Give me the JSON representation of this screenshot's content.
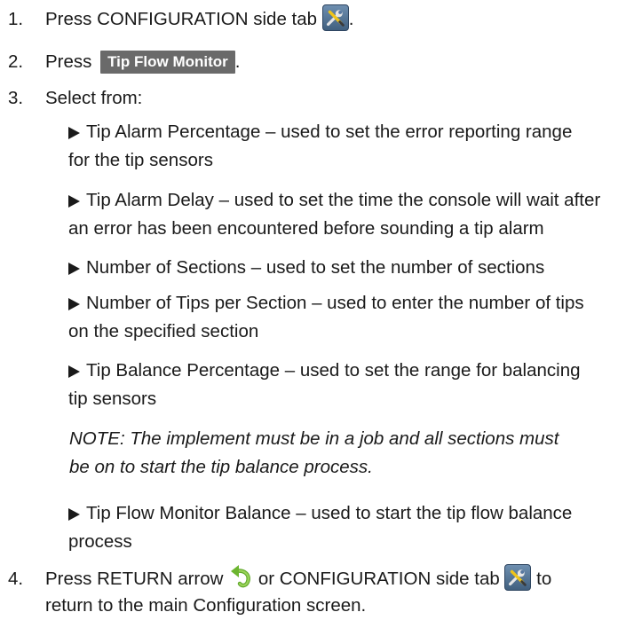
{
  "steps": [
    {
      "number": "1.",
      "text": "Press CONFIGURATION side tab",
      "end": "."
    },
    {
      "number": "2.",
      "text": "Press",
      "button": "Tip Flow Monitor",
      "end": "."
    },
    {
      "number": "3.",
      "text": "Select from:"
    },
    {
      "number": "4.",
      "text_a": "Press RETURN arrow",
      "text_b": "or CONFIGURATION side tab",
      "text_c": "to",
      "text_line2": "return to the main Configuration screen."
    }
  ],
  "options": [
    {
      "line1": "Tip Alarm Percentage – used to set the error reporting range",
      "line2": "for the tip sensors"
    },
    {
      "line1": "Tip Alarm Delay – used to set the time the console will wait after",
      "line2": "an error has been encountered before sounding a tip alarm"
    },
    {
      "line1": "Number of Sections – used to set the number of sections",
      "line2": ""
    },
    {
      "line1": "Number of Tips per Section – used to enter the number of tips",
      "line2": "on the specified section"
    },
    {
      "line1": "Tip Balance Percentage – used to set the range for balancing",
      "line2": "tip sensors"
    },
    {
      "line1": "Tip Flow Monitor Balance – used to start the tip flow balance",
      "line2": "process"
    }
  ],
  "note": {
    "line1": "NOTE: The implement must be in a job and all sections must",
    "line2": "be on to start the tip balance process."
  },
  "icons": {
    "configuration_tab": "configuration-tools-icon",
    "return_arrow": "return-arrow-icon"
  },
  "colors": {
    "button_bg": "#6a6a6a",
    "icon_bg": "#4f6f90",
    "return_arrow": "#7dc142"
  }
}
